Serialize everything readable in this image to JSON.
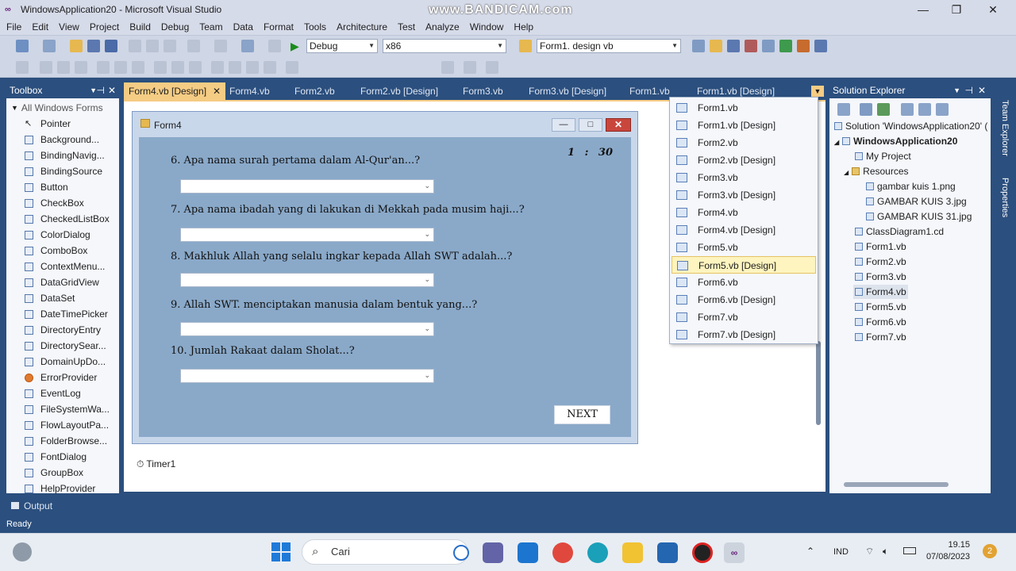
{
  "window": {
    "title": "WindowsApplication20 - Microsoft Visual Studio",
    "watermark": "www.BANDICAM.com",
    "minimize": "—",
    "maximize": "❐",
    "close": "✕"
  },
  "menu": [
    "File",
    "Edit",
    "View",
    "Project",
    "Build",
    "Debug",
    "Team",
    "Data",
    "Format",
    "Tools",
    "Architecture",
    "Test",
    "Analyze",
    "Window",
    "Help"
  ],
  "toolbar": {
    "config": "Debug",
    "platform": "x86",
    "find": "Form1. design vb"
  },
  "toolbox": {
    "title": "Toolbox",
    "section": "All Windows Forms",
    "items": [
      "Pointer",
      "Background...",
      "BindingNavig...",
      "BindingSource",
      "Button",
      "CheckBox",
      "CheckedListBox",
      "ColorDialog",
      "ComboBox",
      "ContextMenu...",
      "DataGridView",
      "DataSet",
      "DateTimePicker",
      "DirectoryEntry",
      "DirectorySear...",
      "DomainUpDo...",
      "ErrorProvider",
      "EventLog",
      "FileSystemWa...",
      "FlowLayoutPa...",
      "FolderBrowse...",
      "FontDialog",
      "GroupBox",
      "HelpProvider"
    ]
  },
  "doc_tabs": [
    "Form4.vb [Design]",
    "Form4.vb",
    "Form2.vb",
    "Form2.vb [Design]",
    "Form3.vb",
    "Form3.vb [Design]",
    "Form1.vb",
    "Form1.vb [Design]"
  ],
  "form": {
    "title": "Form4",
    "timer_display": "1 : 30",
    "questions": [
      "6. Apa nama surah pertama dalam Al-Qur'an...?",
      "7. Apa nama ibadah yang di lakukan di Mekkah pada musim haji...?",
      "8. Makhluk Allah yang selalu ingkar kepada Allah SWT adalah...?",
      "9. Allah SWT. menciptakan manusia dalam bentuk yang...?",
      "10. Jumlah Rakaat dalam Sholat...?"
    ],
    "next_button": "NEXT",
    "component_tray": "Timer1"
  },
  "open_docs_dropdown": {
    "items": [
      "Form1.vb",
      "Form1.vb [Design]",
      "Form2.vb",
      "Form2.vb [Design]",
      "Form3.vb",
      "Form3.vb [Design]",
      "Form4.vb",
      "Form4.vb [Design]",
      "Form5.vb",
      "Form5.vb [Design]",
      "Form6.vb",
      "Form6.vb [Design]",
      "Form7.vb",
      "Form7.vb [Design]"
    ],
    "selected": "Form5.vb [Design]"
  },
  "solution_explorer": {
    "title": "Solution Explorer",
    "solution": "Solution 'WindowsApplication20' (",
    "project": "WindowsApplication20",
    "items": [
      "My Project",
      "Resources",
      "gambar kuis 1.png",
      "GAMBAR KUIS 3.jpg",
      "GAMBAR KUIS 31.jpg",
      "ClassDiagram1.cd",
      "Form1.vb",
      "Form2.vb",
      "Form3.vb",
      "Form4.vb",
      "Form5.vb",
      "Form6.vb",
      "Form7.vb"
    ],
    "selected": "Form4.vb"
  },
  "side_tabs": [
    "Team Explorer",
    "Properties"
  ],
  "output_tab": "Output",
  "status": "Ready",
  "taskbar": {
    "search": "Cari",
    "lang": "IND",
    "time": "19.15",
    "date": "07/08/2023",
    "notif_count": "2"
  }
}
